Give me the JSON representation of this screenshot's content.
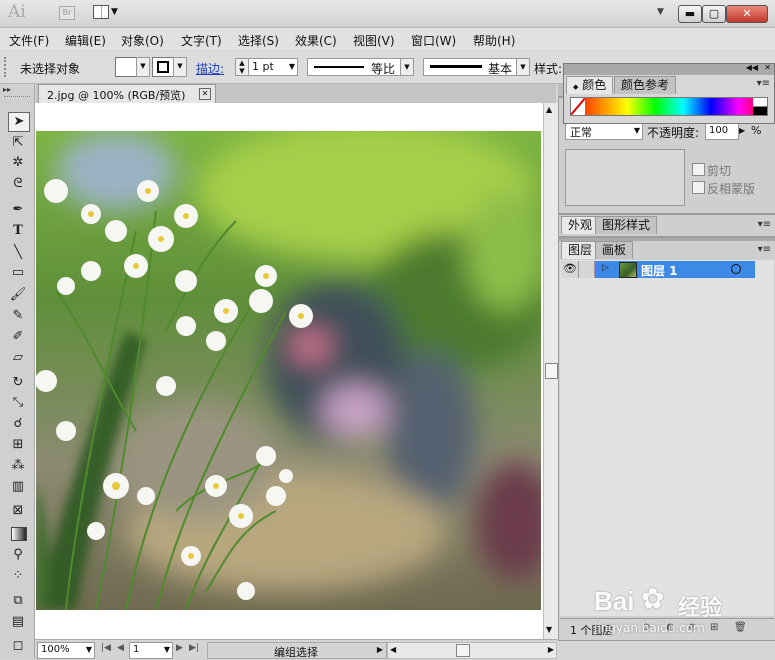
{
  "app": {
    "logo": "Ai",
    "bridge": "Br"
  },
  "menu": [
    "文件(F)",
    "编辑(E)",
    "对象(O)",
    "文字(T)",
    "选择(S)",
    "效果(C)",
    "视图(V)",
    "窗口(W)",
    "帮助(H)"
  ],
  "control": {
    "selection_status": "未选择对象",
    "stroke_label": "描边:",
    "stroke_weight": "1 pt",
    "profile_label": "等比",
    "brush_label": "基本",
    "style_label": "样式:"
  },
  "document": {
    "tab_title": "2.jpg @ 100% (RGB/预览)",
    "zoom": "100%",
    "artboard": "1",
    "status": "编组选择"
  },
  "color_panel": {
    "tabs": [
      "颜色",
      "颜色参考"
    ]
  },
  "transparency_panel": {
    "blend_mode": "正常",
    "opacity_label": "不透明度:",
    "opacity_value": "100",
    "opacity_unit": "%",
    "clip_label": "剪切",
    "invert_label": "反相蒙版"
  },
  "appearance_panel": {
    "tabs": [
      "外观",
      "图形样式"
    ]
  },
  "layers_panel": {
    "tabs": [
      "图层",
      "画板"
    ],
    "layers": [
      {
        "name": "图层 1"
      }
    ],
    "count": "1 个图层"
  },
  "watermark": {
    "brand": "Bai",
    "brand2": "经验",
    "url": "jingyan.baidu.com"
  },
  "colors": {
    "selection_blue": "#3d8ae6",
    "layer_color": "#4f7bff"
  },
  "icons": [
    "selection-tool-icon",
    "direct-selection-icon",
    "magic-wand-icon",
    "lasso-icon",
    "pen-tool-icon",
    "type-tool-icon",
    "line-tool-icon",
    "rectangle-tool-icon",
    "paintbrush-icon",
    "pencil-icon",
    "blob-brush-icon",
    "eraser-icon",
    "rotate-icon",
    "scale-icon",
    "warp-icon",
    "free-transform-icon",
    "symbol-sprayer-icon",
    "graph-tool-icon",
    "mesh-icon",
    "gradient-icon",
    "eyedropper-icon",
    "blend-icon",
    "artboard-icon",
    "slice-icon",
    "eye-icon"
  ]
}
